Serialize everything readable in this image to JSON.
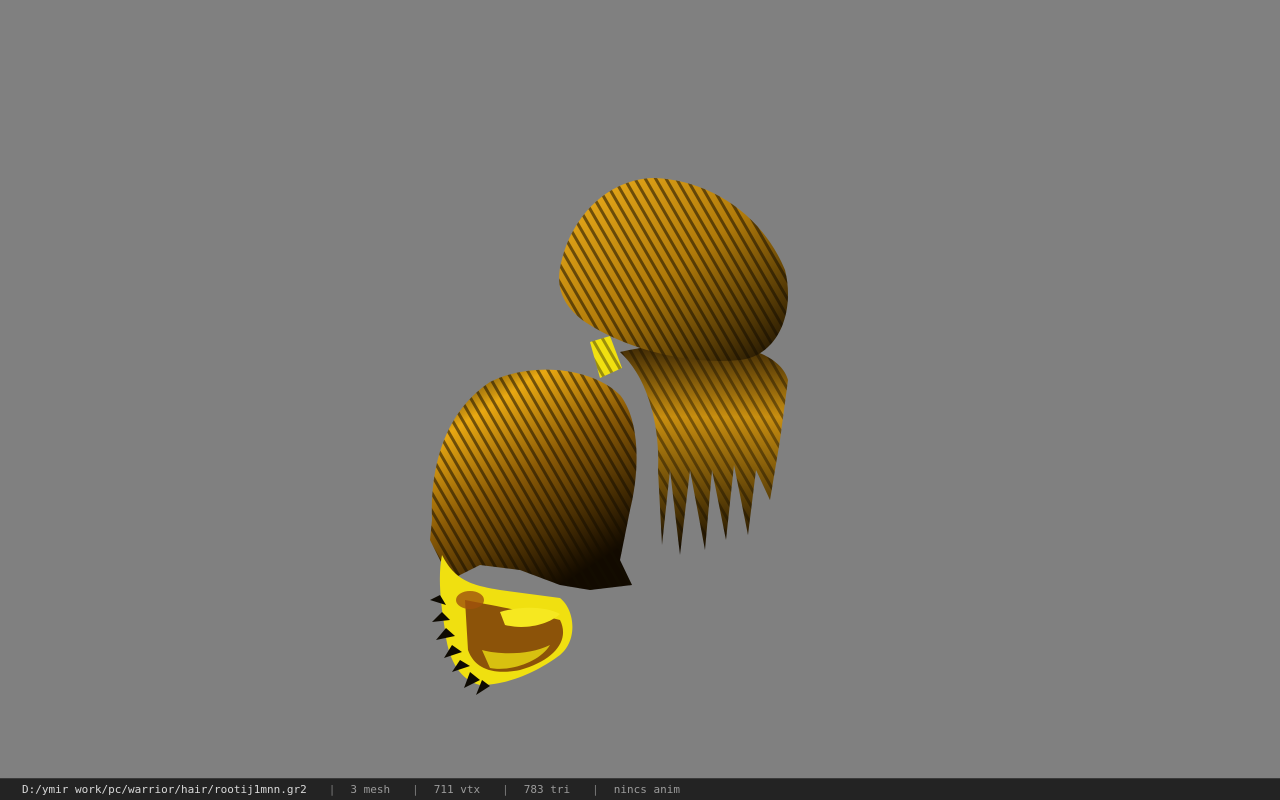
{
  "viewer": {
    "file_path": "D:/ymir work/pc/warrior/hair/rootij1mnn.gr2",
    "separator": "|",
    "stats": {
      "mesh": "3 mesh",
      "vtx": "711 vtx",
      "tri": "783 tri",
      "anim": "nincs anim"
    }
  },
  "colors": {
    "background": "#808080",
    "statusbar": "#232323",
    "hair_gold": "#e0a416",
    "hair_dark": "#1a1204",
    "band_yellow": "#f0e010"
  }
}
